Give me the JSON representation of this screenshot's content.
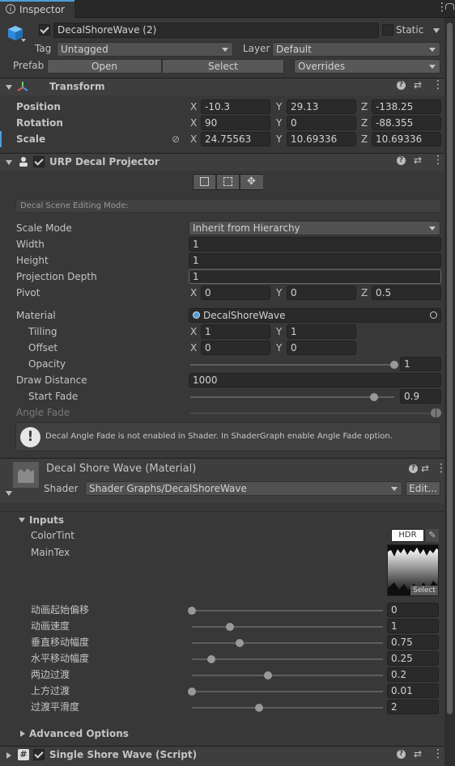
{
  "tab": {
    "title": "Inspector"
  },
  "object": {
    "name": "DecalShoreWave (2)",
    "static_label": "Static",
    "tag_label": "Tag",
    "tag_value": "Untagged",
    "layer_label": "Layer",
    "layer_value": "Default",
    "prefab_label": "Prefab",
    "open_label": "Open",
    "select_label": "Select",
    "overrides_label": "Overrides"
  },
  "transform": {
    "title": "Transform",
    "rows": [
      {
        "label": "Position",
        "x": "-10.3",
        "y": "29.13",
        "z": "-138.25"
      },
      {
        "label": "Rotation",
        "x": "90",
        "y": "0",
        "z": "-88.355"
      },
      {
        "label": "Scale",
        "x": "24.75563",
        "y": "10.69336",
        "z": "10.69336"
      }
    ]
  },
  "axes": {
    "x": "X",
    "y": "Y",
    "z": "Z"
  },
  "decal": {
    "title": "URP Decal Projector",
    "edit_mode_label": "Decal Scene Editing Mode:",
    "scale_mode_label": "Scale Mode",
    "scale_mode_value": "Inherit from Hierarchy",
    "width_label": "Width",
    "width_value": "1",
    "height_label": "Height",
    "height_value": "1",
    "depth_label": "Projection Depth",
    "depth_value": "1",
    "pivot_label": "Pivot",
    "pivot_x": "0",
    "pivot_y": "0",
    "pivot_z": "0.5",
    "material_label": "Material",
    "material_value": "DecalShoreWave",
    "tiling_label": "Tilling",
    "tiling_x": "1",
    "tiling_y": "1",
    "offset_label": "Offset",
    "offset_x": "0",
    "offset_y": "0",
    "opacity_label": "Opacity",
    "opacity_value": "1",
    "opacity_level": 1.0,
    "draw_distance_label": "Draw Distance",
    "draw_distance_value": "1000",
    "start_fade_label": "Start Fade",
    "start_fade_value": "0.9",
    "start_fade_level": 0.9,
    "angle_fade_label": "Angle Fade",
    "warning": "Decal Angle Fade is not enabled in Shader. In ShaderGraph enable Angle Fade option."
  },
  "material": {
    "title": "Decal Shore Wave (Material)",
    "shader_label": "Shader",
    "shader_value": "Shader Graphs/DecalShoreWave",
    "edit_label": "Edit..."
  },
  "inputs": {
    "title": "Inputs",
    "color_tint_label": "ColorTint",
    "hdr_label": "HDR",
    "main_tex_label": "MainTex",
    "tex_select_label": "Select",
    "sliders": [
      {
        "label": "动画起始偏移",
        "value": "0",
        "level": 0.0
      },
      {
        "label": "动画速度",
        "value": "1",
        "level": 0.2
      },
      {
        "label": "垂直移动幅度",
        "value": "0.75",
        "level": 0.25
      },
      {
        "label": "水平移动幅度",
        "value": "0.25",
        "level": 0.1
      },
      {
        "label": "两边过渡",
        "value": "0.2",
        "level": 0.4
      },
      {
        "label": "上方过渡",
        "value": "0.01",
        "level": 0.0
      },
      {
        "label": "过渡平滑度",
        "value": "2",
        "level": 0.35
      }
    ]
  },
  "advanced": {
    "title": "Advanced Options"
  },
  "script": {
    "title": "Single Shore Wave (Script)"
  },
  "colors": {
    "bg": "#383838",
    "header": "#3e3e3e",
    "field": "#2a2a2a",
    "accent": "#4c9ed9"
  }
}
